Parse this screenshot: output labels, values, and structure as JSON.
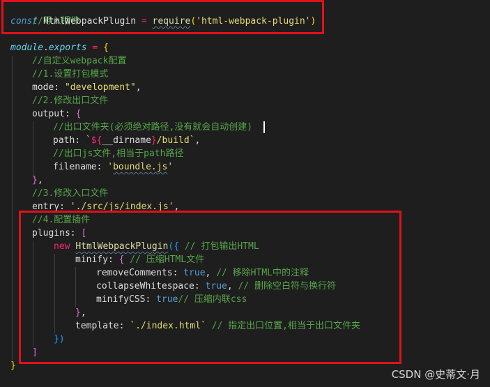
{
  "code": {
    "line1_comment": "//导入插件",
    "line2": {
      "keyword": "const",
      "name": "HtmlWebpackPlugin",
      "eq": "=",
      "func": "require",
      "paren_open": "(",
      "arg": "'html-webpack-plugin'",
      "paren_close": ")"
    },
    "line4": {
      "obj": "module",
      "dot": ".",
      "prop": "exports",
      "eq": "=",
      "brace": "{"
    },
    "line5_comment": "//自定义webpack配置",
    "line6_comment": "//1.设置打包模式",
    "line7": {
      "key": "mode:",
      "value": "\"development\"",
      "comma": ","
    },
    "line8_comment": "//2.修改出口文件",
    "line9": {
      "key": "output:",
      "brace": "{"
    },
    "line10_comment": "//出口文件夹(必须绝对路径,没有就会自动创建)",
    "line11": {
      "key": "path:",
      "tick_open": "`",
      "interp_open": "${",
      "var": "__dirname",
      "interp_close": "}",
      "rest": "/build",
      "tick_close": "`",
      "comma": ","
    },
    "line12_comment": "//出口js文件,相当于path路径",
    "line13": {
      "key": "filename:",
      "q1": "'",
      "value": "boundle.js",
      "q2": "'"
    },
    "line14": {
      "brace": "}",
      "comma": ","
    },
    "line15_comment": "//3.修改入口文件",
    "line16": {
      "key": "entry:",
      "value": "'./src/js/index.js'",
      "comma": ","
    },
    "line17_comment": "//4.配置插件",
    "line18": {
      "key": "plugins:",
      "bracket": "["
    },
    "line19": {
      "keyword": "new",
      "cls": "HtmlWebpackPlugin",
      "open": "({",
      "comment": "// 打包输出HTML"
    },
    "line20": {
      "key": "minify:",
      "brace": "{",
      "comment": "// 压缩HTML文件"
    },
    "line21": {
      "key": "removeComments:",
      "value": "true",
      "comma": ",",
      "comment": "// 移除HTML中的注释"
    },
    "line22": {
      "key": "collapseWhitespace:",
      "value": "true",
      "comma": ",",
      "comment": "// 删除空白符与换行符"
    },
    "line23": {
      "key": "minifyCSS:",
      "value": "true",
      "comment": "// 压缩内联css"
    },
    "line24": {
      "brace": "}",
      "comma": ","
    },
    "line25": {
      "key": "template:",
      "value": "`./index.html`",
      "comment": "// 指定出口位置,相当于出口文件夹"
    },
    "line26": {
      "close": "})"
    },
    "line27": {
      "bracket": "]"
    },
    "line28": {
      "brace": "}"
    }
  },
  "watermark": "CSDN @史蒂文·月",
  "colors": {
    "background": "#1e1e1e",
    "comment": "#57a64a",
    "highlight_box": "#e0111a"
  }
}
